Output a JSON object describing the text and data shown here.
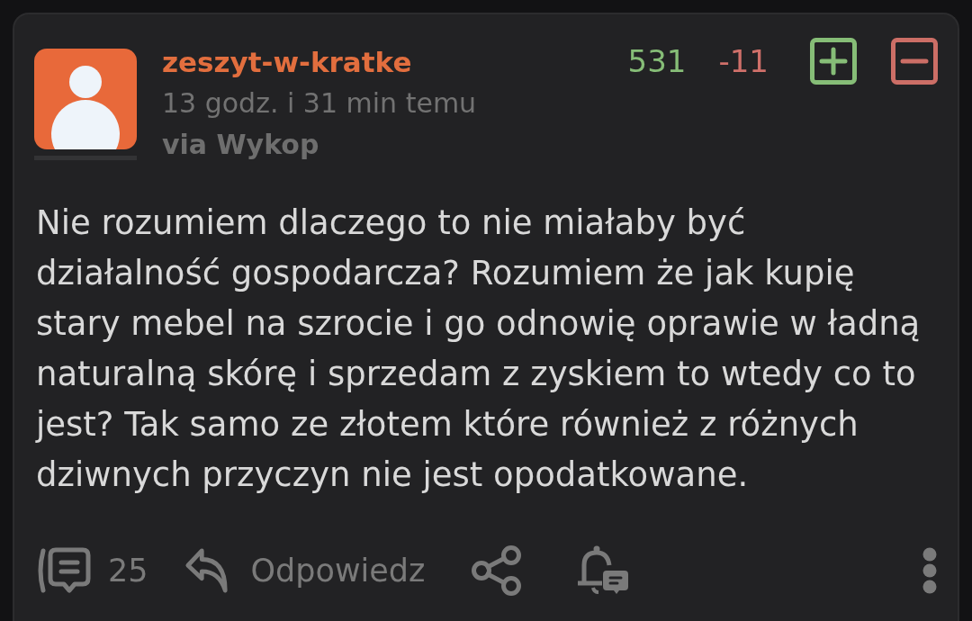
{
  "post": {
    "author": {
      "name": "zeszyt-w-kratke",
      "time": "13 godz. i 31 min temu",
      "source": "via Wykop"
    },
    "votes": {
      "up_count": "531",
      "down_count": "-11"
    },
    "body": "Nie rozumiem dlaczego to nie miałaby być działalność gospodarcza? Rozumiem że jak kupię stary mebel na szrocie i go odnowię oprawie w ładną naturalną skórę i sprzedam z zyskiem to wtedy co to jest? Tak samo ze złotem które również z różnych dziwnych przyczyn nie jest opodatkowane.",
    "actions": [
      {
        "kind": "comments",
        "label": "25"
      },
      {
        "kind": "reply",
        "label": "Odpowiedz"
      },
      {
        "kind": "share"
      },
      {
        "kind": "subscribe"
      },
      {
        "kind": "more"
      }
    ]
  }
}
